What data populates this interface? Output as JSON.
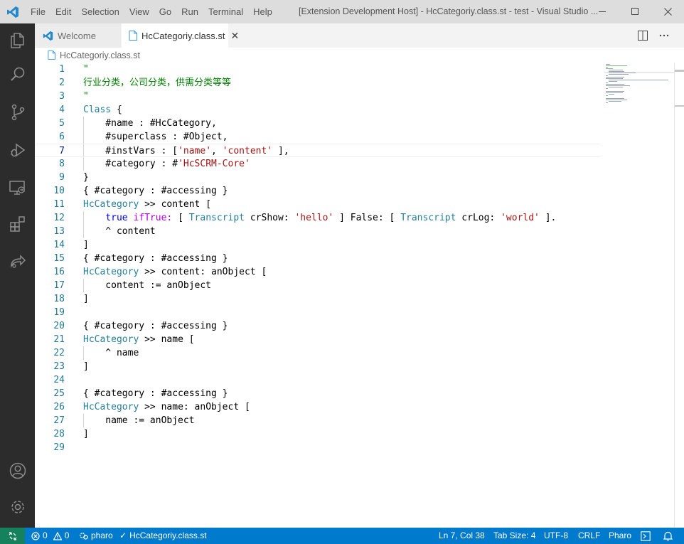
{
  "titlebar": {
    "menus": [
      "File",
      "Edit",
      "Selection",
      "View",
      "Go",
      "Run",
      "Terminal",
      "Help"
    ],
    "window_title": "[Extension Development Host] - HcCategoriy.class.st - test - Visual Studio ..."
  },
  "tabs": [
    {
      "label": "Welcome"
    },
    {
      "label": "HcCategoriy.class.st"
    }
  ],
  "breadcrumb": {
    "file": "HcCategoriy.class.st"
  },
  "editor": {
    "line_numbers": [
      "1",
      "2",
      "3",
      "4",
      "5",
      "6",
      "7",
      "8",
      "9",
      "10",
      "11",
      "12",
      "13",
      "14",
      "15",
      "16",
      "17",
      "18",
      "19",
      "20",
      "21",
      "22",
      "23",
      "24",
      "25",
      "26",
      "27",
      "28",
      "29"
    ],
    "current_line": 7
  },
  "statusbar": {
    "problems_errors": "0",
    "problems_warnings": "0",
    "project": "pharo",
    "file_check": "HcCategoriy.class.st",
    "cursor": "Ln 7, Col 38",
    "tab_size": "Tab Size: 4",
    "encoding": "UTF-8",
    "eol": "CRLF",
    "language": "Pharo"
  },
  "colors": {
    "activity_bar": "#2c2c2c",
    "status_bar": "#007acc",
    "remote_indicator": "#16825d",
    "title_bar": "#dddddd",
    "line_number": "#237893",
    "keyword": "#0000ff",
    "class": "#267f99",
    "string": "#a31515",
    "comment": "#008000"
  }
}
